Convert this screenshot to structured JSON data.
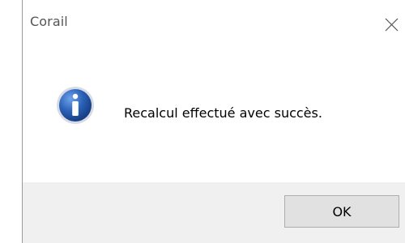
{
  "window": {
    "title": "Corail",
    "close_icon": "close-icon"
  },
  "message": {
    "icon": "info-icon",
    "text": "Recalcul effectué avec succès.",
    "icon_color": "#2b62b8"
  },
  "buttons": {
    "ok_label": "OK"
  },
  "colors": {
    "footer_background": "#f0f0f0",
    "button_background": "#e1e1e1",
    "button_border": "#adadad"
  }
}
